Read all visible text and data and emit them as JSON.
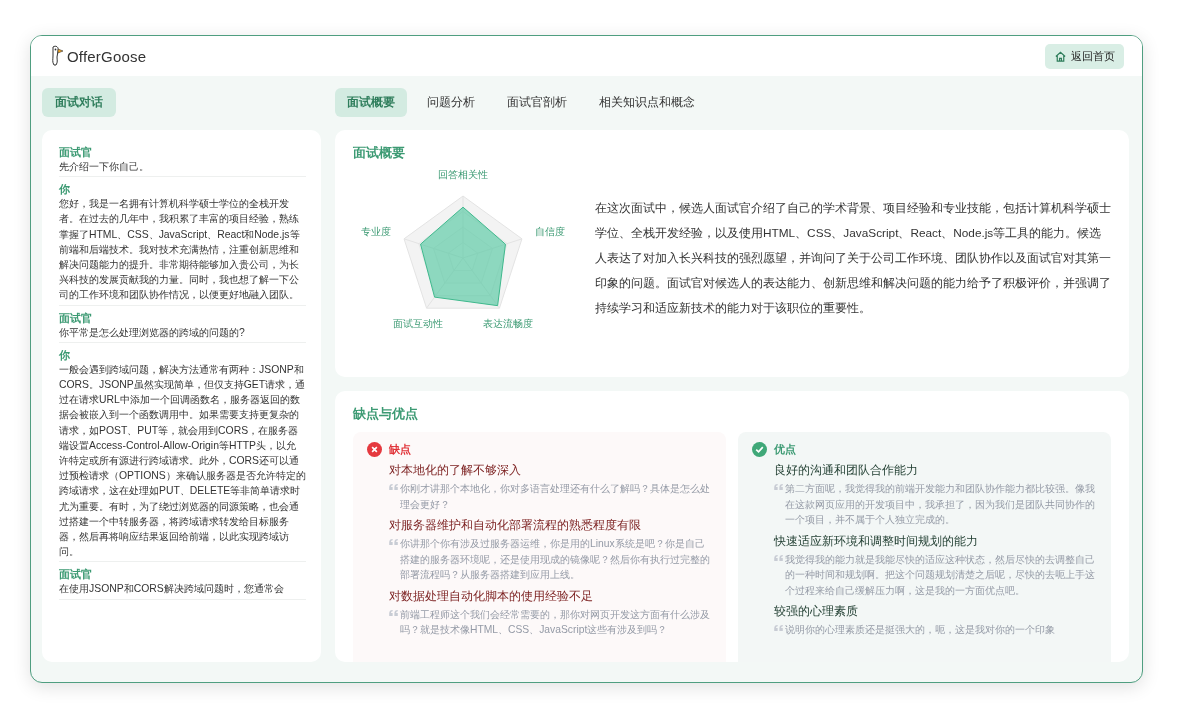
{
  "header": {
    "logo": "OfferGoose",
    "home_button": "返回首页"
  },
  "sidebar": {
    "tab": "面试对话",
    "messages": [
      {
        "speaker": "面试官",
        "text": "先介绍一下你自己。"
      },
      {
        "speaker": "你",
        "text": "您好，我是一名拥有计算机科学硕士学位的全栈开发者。在过去的几年中，我积累了丰富的项目经验，熟练掌握了HTML、CSS、JavaScript、React和Node.js等前端和后端技术。我对技术充满热情，注重创新思维和解决问题能力的提升。非常期待能够加入贵公司，为长兴科技的发展贡献我的力量。同时，我也想了解一下公司的工作环境和团队协作情况，以便更好地融入团队。"
      },
      {
        "speaker": "面试官",
        "text": "你平常是怎么处理浏览器的跨域的问题的?"
      },
      {
        "speaker": "你",
        "text": "一般会遇到跨域问题，解决方法通常有两种：JSONP和CORS。JSONP虽然实现简单，但仅支持GET请求，通过在请求URL中添加一个回调函数名，服务器返回的数据会被嵌入到一个函数调用中。如果需要支持更复杂的请求，如POST、PUT等，就会用到CORS，在服务器端设置Access-Control-Allow-Origin等HTTP头，以允许特定或所有源进行跨域请求。此外，CORS还可以通过预检请求（OPTIONS）来确认服务器是否允许特定的跨域请求，这在处理如PUT、DELETE等非简单请求时尤为重要。有时，为了绕过浏览器的同源策略，也会通过搭建一个中转服务器，将跨域请求转发给目标服务器，然后再将响应结果返回给前端，以此实现跨域访问。"
      },
      {
        "speaker": "面试官",
        "text": "在使用JSONP和CORS解决跨域问题时，您通常会"
      }
    ]
  },
  "tabs": [
    {
      "label": "面试概要",
      "selected": true
    },
    {
      "label": "问题分析",
      "selected": false
    },
    {
      "label": "面试官剖析",
      "selected": false
    },
    {
      "label": "相关知识点和概念",
      "selected": false
    }
  ],
  "summary": {
    "title": "面试概要",
    "radar_labels": [
      "回答相关性",
      "自信度",
      "表达流畅度",
      "面试互动性",
      "专业度"
    ],
    "text": "在这次面试中，候选人面试官介绍了自己的学术背景、项目经验和专业技能，包括计算机科学硕士学位、全栈开发经验，以及使用HTML、CSS、JavaScript、React、Node.js等工具的能力。候选人表达了对加入长兴科技的强烈愿望，并询问了关于公司工作环境、团队协作以及面试官对其第一印象的问题。面试官对候选人的表达能力、创新思维和解决问题的能力给予了积极评价，并强调了持续学习和适应新技术的能力对于该职位的重要性。"
  },
  "review": {
    "title": "缺点与优点",
    "groups": [
      {
        "kind": "weakness",
        "title": "缺点",
        "items": [
          {
            "title": "对本地化的了解不够深入",
            "quote": "你刚才讲那个本地化，你对多语言处理还有什么了解吗？具体是怎么处理会更好？"
          },
          {
            "title": "对服务器维护和自动化部署流程的熟悉程度有限",
            "quote": "你讲那个你有涉及过服务器运维，你是用的Linux系统是吧？你是自己搭建的服务器环境呢，还是使用现成的镜像呢？然后你有执行过完整的部署流程吗？从服务器搭建到应用上线。"
          },
          {
            "title": "对数据处理自动化脚本的使用经验不足",
            "quote": "前端工程师这个我们会经常需要的，那你对网页开发这方面有什么涉及吗？就是技术像HTML、CSS、JavaScript这些有涉及到吗？"
          }
        ]
      },
      {
        "kind": "strength",
        "title": "优点",
        "items": [
          {
            "title": "良好的沟通和团队合作能力",
            "quote": "第二方面呢，我觉得我的前端开发能力和团队协作能力都比较强。像我在这款网页应用的开发项目中，我承担了，因为我们是团队共同协作的一个项目，并不属于个人独立完成的。"
          },
          {
            "title": "快速适应新环境和调整时间规划的能力",
            "quote": "我觉得我的能力就是我能尽快的适应这种状态，然后尽快的去调整自己的一种时间和规划啊。把这个问题规划清楚之后呢，尽快的去呃上手这个过程来给自己缓解压力啊，这是我的一方面优点吧。"
          },
          {
            "title": "较强的心理素质",
            "quote": "说明你的心理素质还是挺强大的，呃，这是我对你的一个印象"
          }
        ]
      }
    ]
  }
}
